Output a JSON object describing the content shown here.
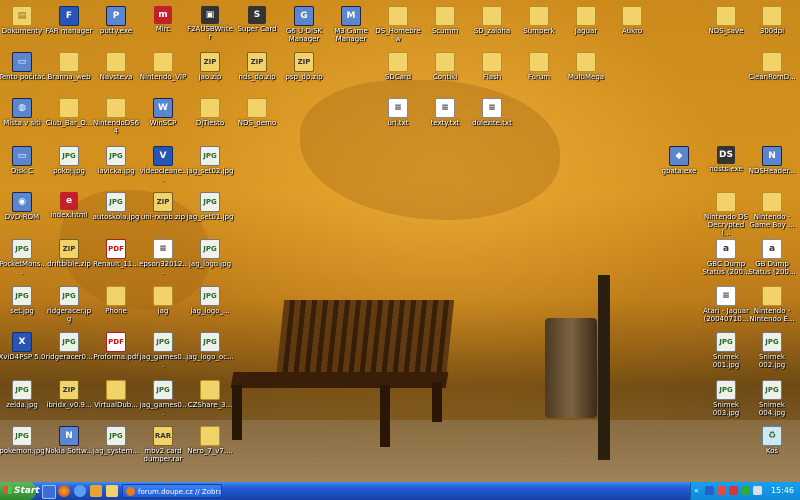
{
  "desktop": {
    "icons": [
      {
        "label": "Dokumenty",
        "glyph": "▤",
        "kind": "folder"
      },
      {
        "label": "FAR manager",
        "glyph": "F",
        "kind": "app"
      },
      {
        "label": "putty.exe",
        "glyph": "P",
        "kind": "sys"
      },
      {
        "label": "Mirc",
        "glyph": "m",
        "kind": "red"
      },
      {
        "label": "F2AUSBWriter",
        "glyph": "▣",
        "kind": "dark"
      },
      {
        "label": "Super Card",
        "glyph": "S",
        "kind": "dark"
      },
      {
        "label": "G6 U-DISK Manager",
        "glyph": "G",
        "kind": "sys"
      },
      {
        "label": "M3 Game Manager",
        "glyph": "M",
        "kind": "sys"
      },
      {
        "label": "DS_Homebrew",
        "glyph": "",
        "kind": "folder"
      },
      {
        "label": "Scumm",
        "glyph": "",
        "kind": "folder"
      },
      {
        "label": "SD_zaloha",
        "glyph": "",
        "kind": "folder"
      },
      {
        "label": "Sumperk",
        "glyph": "",
        "kind": "folder"
      },
      {
        "label": "Jaguar",
        "glyph": "",
        "kind": "folder"
      },
      {
        "label": "Aukro",
        "glyph": "",
        "kind": "folder"
      },
      {
        "label": "NDS_save",
        "glyph": "",
        "kind": "folder"
      },
      {
        "label": "300dpi",
        "glyph": "",
        "kind": "folder"
      },
      {
        "label": "Tento počítač",
        "glyph": "▭",
        "kind": "sys"
      },
      {
        "label": "Branna_web",
        "glyph": "",
        "kind": "folder"
      },
      {
        "label": "Navsteva",
        "glyph": "",
        "kind": "folder"
      },
      {
        "label": "Nintendo_VIP",
        "glyph": "",
        "kind": "folder"
      },
      {
        "label": "jao.zip",
        "glyph": "ZIP",
        "kind": "zip"
      },
      {
        "label": "nds_dp.zip",
        "glyph": "ZIP",
        "kind": "zip"
      },
      {
        "label": "psp_dp.zip",
        "glyph": "ZIP",
        "kind": "zip"
      },
      {
        "label": "SDCard",
        "glyph": "",
        "kind": "folder"
      },
      {
        "label": "Contiki",
        "glyph": "",
        "kind": "folder"
      },
      {
        "label": "Flash",
        "glyph": "",
        "kind": "folder"
      },
      {
        "label": "Forum",
        "glyph": "",
        "kind": "folder"
      },
      {
        "label": "MultiMega",
        "glyph": "",
        "kind": "folder"
      },
      {
        "label": "CleanRomD...",
        "glyph": "",
        "kind": "folder"
      },
      {
        "label": "Místa v síti",
        "glyph": "◍",
        "kind": "sys"
      },
      {
        "label": "Club_Bar_O...",
        "glyph": "",
        "kind": "folder"
      },
      {
        "label": "NintendoDS64",
        "glyph": "",
        "kind": "folder"
      },
      {
        "label": "WinSCP",
        "glyph": "W",
        "kind": "sys"
      },
      {
        "label": "DjTiesto",
        "glyph": "",
        "kind": "folder"
      },
      {
        "label": "NDS_demo",
        "glyph": "",
        "kind": "folder"
      },
      {
        "label": "url.txt",
        "glyph": "≡",
        "kind": "txt"
      },
      {
        "label": "texty.txt",
        "glyph": "≡",
        "kind": "txt"
      },
      {
        "label": "dulezite.txt",
        "glyph": "≡",
        "kind": "txt"
      },
      {
        "label": "Disk C",
        "glyph": "▭",
        "kind": "sys"
      },
      {
        "label": "pokoj.jpg",
        "glyph": "JPG",
        "kind": "jpg"
      },
      {
        "label": "lavicka.jpg",
        "glyph": "JPG",
        "kind": "jpg"
      },
      {
        "label": "videocleane...",
        "glyph": "V",
        "kind": "app"
      },
      {
        "label": "jag_set02.jpg",
        "glyph": "JPG",
        "kind": "jpg"
      },
      {
        "label": "gbata.exe",
        "glyph": "◆",
        "kind": "sys"
      },
      {
        "label": "ndsts.exe",
        "glyph": "DS",
        "kind": "dark"
      },
      {
        "label": "NDSHeader...",
        "glyph": "N",
        "kind": "sys"
      },
      {
        "label": "DVD-ROM",
        "glyph": "◉",
        "kind": "sys"
      },
      {
        "label": "index.html",
        "glyph": "e",
        "kind": "red"
      },
      {
        "label": "autoskola.jpg",
        "glyph": "JPG",
        "kind": "jpg"
      },
      {
        "label": "uni-rxrpb.zip",
        "glyph": "ZIP",
        "kind": "zip"
      },
      {
        "label": "jag_set01.jpg",
        "glyph": "JPG",
        "kind": "jpg"
      },
      {
        "label": "Nintendo DS Decrypted (...",
        "glyph": "",
        "kind": "folder"
      },
      {
        "label": "Nintendo - Game Boy ...",
        "glyph": "",
        "kind": "folder"
      },
      {
        "label": "PocketMons...",
        "glyph": "JPG",
        "kind": "jpg"
      },
      {
        "label": "driftbible.zip",
        "glyph": "ZIP",
        "kind": "zip"
      },
      {
        "label": "Renault_11...",
        "glyph": "PDF",
        "kind": "pdf"
      },
      {
        "label": "epson32012...",
        "glyph": "≡",
        "kind": "txt"
      },
      {
        "label": "jag_logo.jpg",
        "glyph": "JPG",
        "kind": "jpg"
      },
      {
        "label": "GBC Dump Status (200...",
        "glyph": "a",
        "kind": "txt"
      },
      {
        "label": "GB Dump Status (200...",
        "glyph": "a",
        "kind": "txt"
      },
      {
        "label": "set.jpg",
        "glyph": "JPG",
        "kind": "jpg"
      },
      {
        "label": "ridgeracer.jpg",
        "glyph": "JPG",
        "kind": "jpg"
      },
      {
        "label": "Phone",
        "glyph": "",
        "kind": "folder"
      },
      {
        "label": "jag",
        "glyph": "",
        "kind": "folder"
      },
      {
        "label": "jag_logo_...",
        "glyph": "JPG",
        "kind": "jpg"
      },
      {
        "label": "Atari - Jaguar (20040710...",
        "glyph": "≡",
        "kind": "txt"
      },
      {
        "label": "Nintendo - Nintendo E...",
        "glyph": "",
        "kind": "folder"
      },
      {
        "label": "XviD4PSP 5.0",
        "glyph": "X",
        "kind": "app"
      },
      {
        "label": "ridgeracer0...",
        "glyph": "JPG",
        "kind": "jpg"
      },
      {
        "label": "Proforma.pdf",
        "glyph": "PDF",
        "kind": "pdf"
      },
      {
        "label": "jag_games0...",
        "glyph": "JPG",
        "kind": "jpg"
      },
      {
        "label": "jag_logo_oc...",
        "glyph": "JPG",
        "kind": "jpg"
      },
      {
        "label": "Snimek 001.jpg",
        "glyph": "JPG",
        "kind": "jpg"
      },
      {
        "label": "Snimek 002.jpg",
        "glyph": "JPG",
        "kind": "jpg"
      },
      {
        "label": "zelda.jpg",
        "glyph": "JPG",
        "kind": "jpg"
      },
      {
        "label": "ibridx_v0.9...",
        "glyph": "ZIP",
        "kind": "zip"
      },
      {
        "label": "VirtualDub...",
        "glyph": "",
        "kind": "folder"
      },
      {
        "label": "jag_games0...",
        "glyph": "JPG",
        "kind": "jpg"
      },
      {
        "label": "CZShare_3...",
        "glyph": "",
        "kind": "folder"
      },
      {
        "label": "Snimek 003.jpg",
        "glyph": "JPG",
        "kind": "jpg"
      },
      {
        "label": "Snimek 004.jpg",
        "glyph": "JPG",
        "kind": "jpg"
      },
      {
        "label": "pokemon.jpg",
        "glyph": "JPG",
        "kind": "jpg"
      },
      {
        "label": "Nokia Softw...",
        "glyph": "N",
        "kind": "sys"
      },
      {
        "label": "jag_system...",
        "glyph": "JPG",
        "kind": "jpg"
      },
      {
        "label": "mbv2 card dumper.rar",
        "glyph": "RAR",
        "kind": "zip"
      },
      {
        "label": "Nero_7_v7....",
        "glyph": "",
        "kind": "folder"
      },
      {
        "label": "Koš",
        "glyph": "♻",
        "kind": "recycle"
      }
    ]
  },
  "taskbar": {
    "start_label": "Start",
    "window_title": "forum.doupe.cz // Zobra...",
    "clock": "15:46",
    "tray_chevron": "«"
  }
}
